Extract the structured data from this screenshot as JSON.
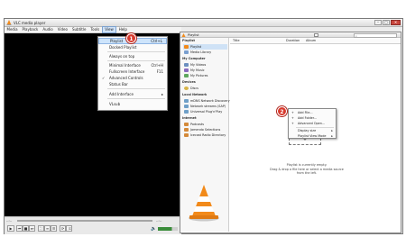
{
  "window": {
    "title": "VLC media player",
    "minimize": "–",
    "maximize": "□",
    "close": "✕"
  },
  "menubar": {
    "items": [
      "Media",
      "Playback",
      "Audio",
      "Video",
      "Subtitle",
      "Tools",
      "View",
      "Help"
    ]
  },
  "view_menu": {
    "items": [
      {
        "label": "Playlist",
        "shortcut": "Ctrl+L",
        "checked": false
      },
      {
        "label": "Docked Playlist",
        "shortcut": "",
        "checked": false
      },
      {
        "label": "Always on top",
        "shortcut": "",
        "checked": false
      },
      {
        "label": "Minimal Interface",
        "shortcut": "Ctrl+H",
        "checked": false
      },
      {
        "label": "Fullscreen Interface",
        "shortcut": "F11",
        "checked": false
      },
      {
        "label": "Advanced Controls",
        "shortcut": "",
        "checked": true
      },
      {
        "label": "Status Bar",
        "shortcut": "",
        "checked": false
      },
      {
        "label": "Add Interface",
        "shortcut": "▸",
        "checked": false
      },
      {
        "label": "VLsub",
        "shortcut": "",
        "checked": false
      }
    ],
    "check_mark": "✓"
  },
  "controls": {
    "time_elapsed": "--:--",
    "time_total": "--:--",
    "volume": 0.7
  },
  "playlist_window": {
    "title": "Playlist",
    "sidebar_header": "Playlist",
    "sections": {
      "playlist": [
        "Playlist",
        "Media Library"
      ],
      "my_computer_header": "My Computer",
      "my_computer": [
        "My Videos",
        "My Music",
        "My Pictures"
      ],
      "devices_header": "Devices",
      "devices": [
        "Discs"
      ],
      "local_network_header": "Local Network",
      "local_network": [
        "mDNS Network Discovery",
        "Network streams (SAP)",
        "Universal Plug'n'Play"
      ],
      "internet_header": "Internet",
      "internet": [
        "Podcasts",
        "Jamendo Selections",
        "Icecast Radio Directory"
      ]
    },
    "columns": {
      "title": "Title",
      "duration": "Duration",
      "album": "Album"
    },
    "empty_line1": "Playlist is currently empty.",
    "empty_line2": "Drag & drop a file here or select a media source from the left."
  },
  "context_menu": {
    "items": [
      "Add File...",
      "Add Folder...",
      "Advanced Open...",
      "Display size",
      "Playlist View Mode"
    ],
    "submenu_arrow": "▸"
  },
  "badges": {
    "one": "1",
    "two": "2"
  },
  "colors": {
    "badge": "#d83a2e",
    "cone_orange": "#f28a1a",
    "selection": "#cde4fb"
  }
}
